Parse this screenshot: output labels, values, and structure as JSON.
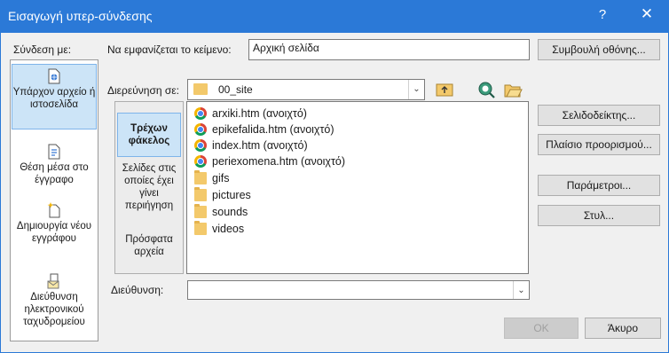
{
  "window": {
    "title": "Εισαγωγή υπερ-σύνδεσης",
    "help_label": "?",
    "close_label": "✕"
  },
  "link_to": {
    "label": "Σύνδεση με:",
    "items": [
      {
        "label": "Υπάρχον αρχείο ή ιστοσελίδα",
        "icon": "existing-file-icon",
        "selected": true
      },
      {
        "label": "Θέση μέσα στο έγγραφο",
        "icon": "place-in-document-icon"
      },
      {
        "label": "Δημιουργία νέου εγγράφου",
        "icon": "new-document-icon"
      },
      {
        "label": "Διεύθυνση ηλεκτρονικού ταχυδρομείου",
        "icon": "email-address-icon"
      }
    ]
  },
  "text_to_display": {
    "label": "Να εμφανίζεται το κείμενο:",
    "value": "Αρχική σελίδα"
  },
  "screentip_button": "Συμβουλή οθόνης...",
  "look_in": {
    "label": "Διερεύνηση σε:",
    "value": "00_site"
  },
  "look_in_sidebar": [
    {
      "label": "Τρέχων φάκελος",
      "selected": true
    },
    {
      "label": "Σελίδες στις οποίες έχει γίνει περιήγηση"
    },
    {
      "label": "Πρόσφατα αρχεία"
    }
  ],
  "files": [
    {
      "name": "arxiki.htm (ανοιχτό)",
      "icon": "chrome-icon"
    },
    {
      "name": "epikefalida.htm (ανοιχτό)",
      "icon": "chrome-icon"
    },
    {
      "name": "index.htm (ανοιχτό)",
      "icon": "chrome-icon"
    },
    {
      "name": "periexomena.htm (ανοιχτό)",
      "icon": "chrome-icon"
    },
    {
      "name": "gifs",
      "icon": "folder-icon"
    },
    {
      "name": "pictures",
      "icon": "folder-icon"
    },
    {
      "name": "sounds",
      "icon": "folder-icon"
    },
    {
      "name": "videos",
      "icon": "folder-icon"
    }
  ],
  "right_buttons": {
    "bookmark": "Σελιδοδείκτης...",
    "target_frame": "Πλαίσιο προορισμού...",
    "parameters": "Παράμετροι...",
    "style": "Στυλ..."
  },
  "address": {
    "label": "Διεύθυνση:",
    "value": ""
  },
  "footer": {
    "ok_label": "ΟΚ",
    "cancel_label": "Άκυρο"
  },
  "colors": {
    "titlebar": "#2b79d7",
    "selection": "#cce4f7"
  }
}
